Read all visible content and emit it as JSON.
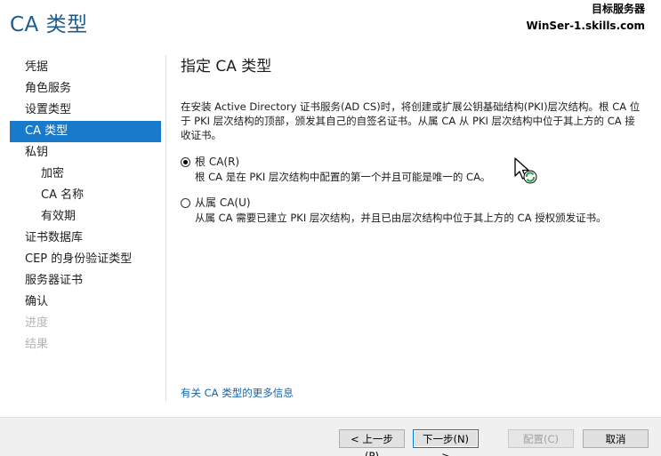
{
  "header": {
    "title": "CA 类型",
    "target_label": "目标服务器",
    "target_server": "WinSer-1.skills.com"
  },
  "sidebar": {
    "items": [
      {
        "label": "凭据",
        "state": "normal"
      },
      {
        "label": "角色服务",
        "state": "normal"
      },
      {
        "label": "设置类型",
        "state": "normal"
      },
      {
        "label": "CA 类型",
        "state": "active"
      },
      {
        "label": "私钥",
        "state": "normal"
      },
      {
        "label": "加密",
        "state": "normal"
      },
      {
        "label": "CA 名称",
        "state": "normal"
      },
      {
        "label": "有效期",
        "state": "normal"
      },
      {
        "label": "证书数据库",
        "state": "normal"
      },
      {
        "label": "CEP 的身份验证类型",
        "state": "normal"
      },
      {
        "label": "服务器证书",
        "state": "normal"
      },
      {
        "label": "确认",
        "state": "normal"
      },
      {
        "label": "进度",
        "state": "disabled"
      },
      {
        "label": "结果",
        "state": "disabled"
      }
    ]
  },
  "main": {
    "title": "指定 CA 类型",
    "description": "在安装 Active Directory 证书服务(AD CS)时，将创建或扩展公钥基础结构(PKI)层次结构。根 CA 位于 PKI 层次结构的顶部，颁发其自己的自签名证书。从属 CA 从 PKI 层次结构中位于其上方的 CA 接收证书。",
    "options": [
      {
        "label": "根 CA(R)",
        "description": "根 CA 是在 PKI 层次结构中配置的第一个并且可能是唯一的 CA。",
        "checked": true
      },
      {
        "label": "从属 CA(U)",
        "description": "从属 CA 需要已建立 PKI 层次结构，并且已由层次结构中位于其上方的 CA 授权颁发证书。",
        "checked": false
      }
    ],
    "more_link": "有关 CA 类型的更多信息"
  },
  "footer": {
    "prev_label": "< 上一步(P)",
    "next_label": "下一步(N) >",
    "configure_label": "配置(C)",
    "cancel_label": "取消"
  },
  "colors": {
    "accent": "#1979ca",
    "title": "#1c5b8a",
    "link": "#1564a8"
  },
  "icons": {
    "cursor": "busy-cursor-icon"
  }
}
